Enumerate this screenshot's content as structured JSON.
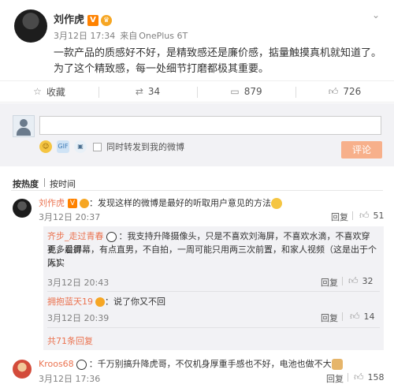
{
  "post": {
    "author": "刘作虎",
    "v_badge": "V",
    "date": "3月12日 17:34",
    "source_prefix": "来自",
    "source": "OnePlus 6T",
    "text": "一款产品的质感好不好，是精致感还是廉价感，掂量触摸真机就知道了。为了这个精致感，每一处细节打磨都极其重要。",
    "chevron": "chevron-down-icon"
  },
  "actions": [
    {
      "label": "收藏",
      "icon": "star-icon"
    },
    {
      "label": "34",
      "icon": "repost-icon"
    },
    {
      "label": "879",
      "icon": "comment-icon"
    },
    {
      "label": "726",
      "icon": "thumbs-up-icon"
    }
  ],
  "compose": {
    "placeholder": "",
    "also_repost": "同时转发到我的微博",
    "submit": "评论"
  },
  "sort": {
    "hot": "按热度",
    "time": "按时间"
  },
  "comments": {
    "c1": {
      "name": "刘作虎",
      "text": "：发现这样的微博是最好的听取用户意见的方法",
      "time": "3月12日 20:37",
      "reply": "回复",
      "likes": "51"
    },
    "c2": {
      "name": "齐步_走过青春",
      "text_line1": "：我支持升降摄像头，只是不喜欢刘海屏，不喜欢水滴，不喜欢穿孔，看得",
      "text_line2": "更多是屏幕，有点直男，不自拍，一周可能只用两三次前置，和家人视频（这是出于个人实",
      "text_line3": "际）",
      "time": "3月12日 20:43",
      "reply": "回复",
      "likes": "32"
    },
    "c3": {
      "name": "拥抱蓝天19",
      "text": "：说了你又不回",
      "time": "3月12日 20:39",
      "reply": "回复",
      "likes": "14"
    },
    "more": "共71条回复",
    "c4": {
      "name": "Kroos68",
      "text": "：千万别搞升降虎哥，不仅机身厚重手感也不好，电池也做不大",
      "time": "3月12日 17:36",
      "reply": "回复",
      "likes": "158"
    }
  }
}
